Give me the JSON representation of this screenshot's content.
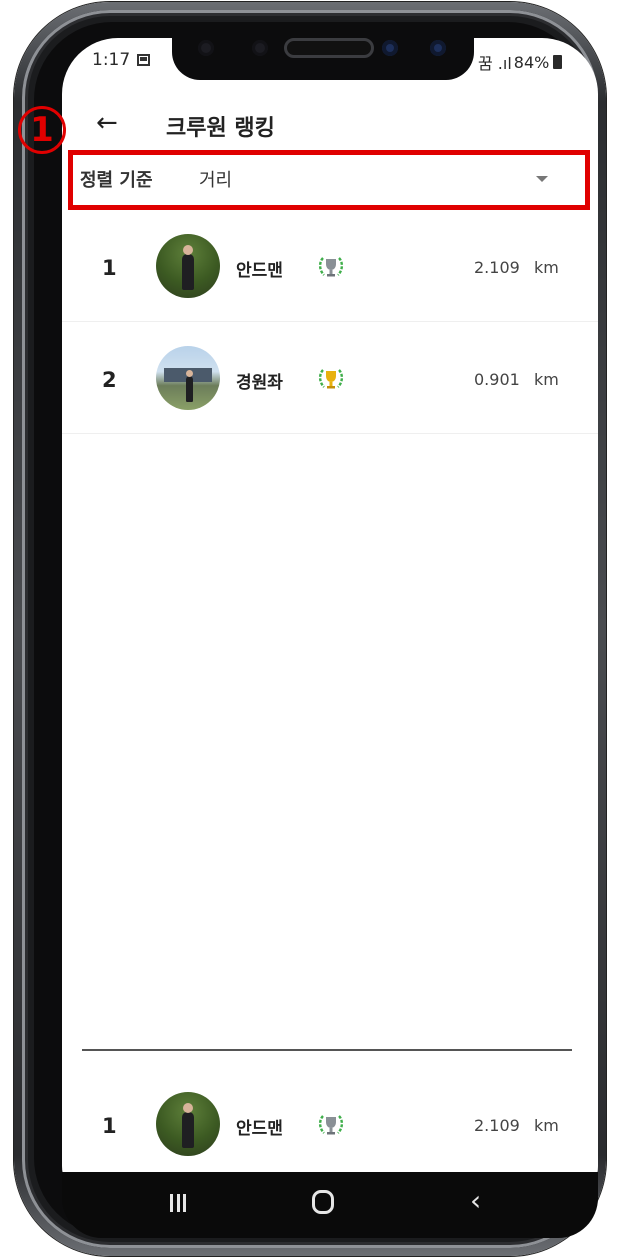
{
  "status_bar": {
    "time": "1:17",
    "signal": "꿈 .ıl",
    "battery": "84%"
  },
  "annotation": {
    "marker": "1"
  },
  "header": {
    "back": "←",
    "title": "크루원 랭킹"
  },
  "sort": {
    "label": "정렬 기준",
    "value": "거리"
  },
  "rankings": [
    {
      "rank": "1",
      "name": "안드맨",
      "distance": "2.109",
      "unit": "km",
      "trophy": "silver-trophy-icon"
    },
    {
      "rank": "2",
      "name": "경원좌",
      "distance": "0.901",
      "unit": "km",
      "trophy": "gold-trophy-icon"
    }
  ],
  "my_rank": {
    "rank": "1",
    "name": "안드맨",
    "distance": "2.109",
    "unit": "km",
    "trophy": "silver-trophy-icon"
  },
  "colors": {
    "annotation": "#e00000",
    "laurel": "#3fae4a",
    "gold": "#e8b10e",
    "silver": "#8a9096"
  },
  "nav": {
    "back": "‹"
  }
}
